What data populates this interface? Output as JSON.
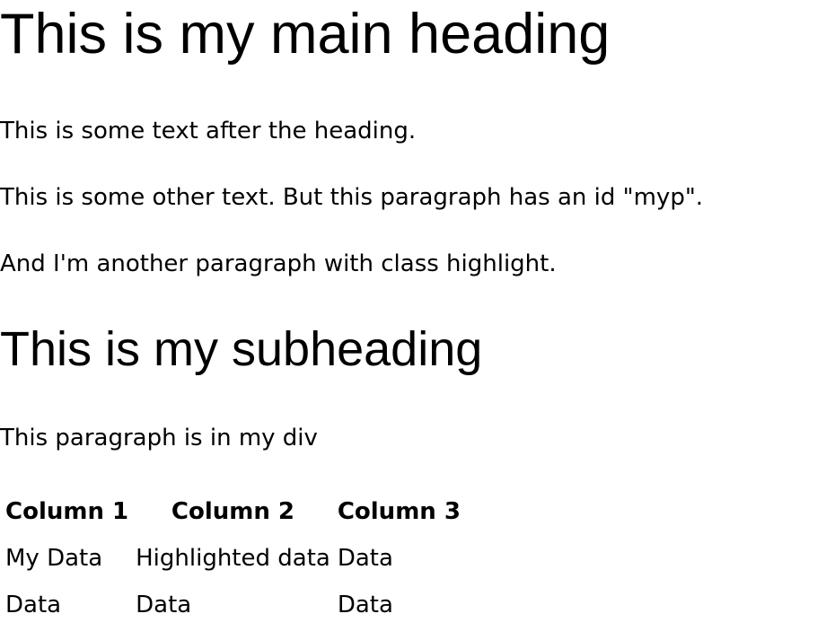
{
  "heading_main": "This is my main heading",
  "paragraphs": [
    "This is some text after the heading.",
    "This is some other text. But this paragraph has an id \"myp\".",
    "And I'm another paragraph with class highlight."
  ],
  "subheading": "This is my subheading",
  "div_paragraph": "This paragraph is in my div",
  "table": {
    "headers": [
      "Column 1",
      "Column 2",
      "Column 3"
    ],
    "rows": [
      [
        "My Data",
        "Highlighted data",
        "Data"
      ],
      [
        "Data",
        "Data",
        "Data"
      ]
    ]
  }
}
